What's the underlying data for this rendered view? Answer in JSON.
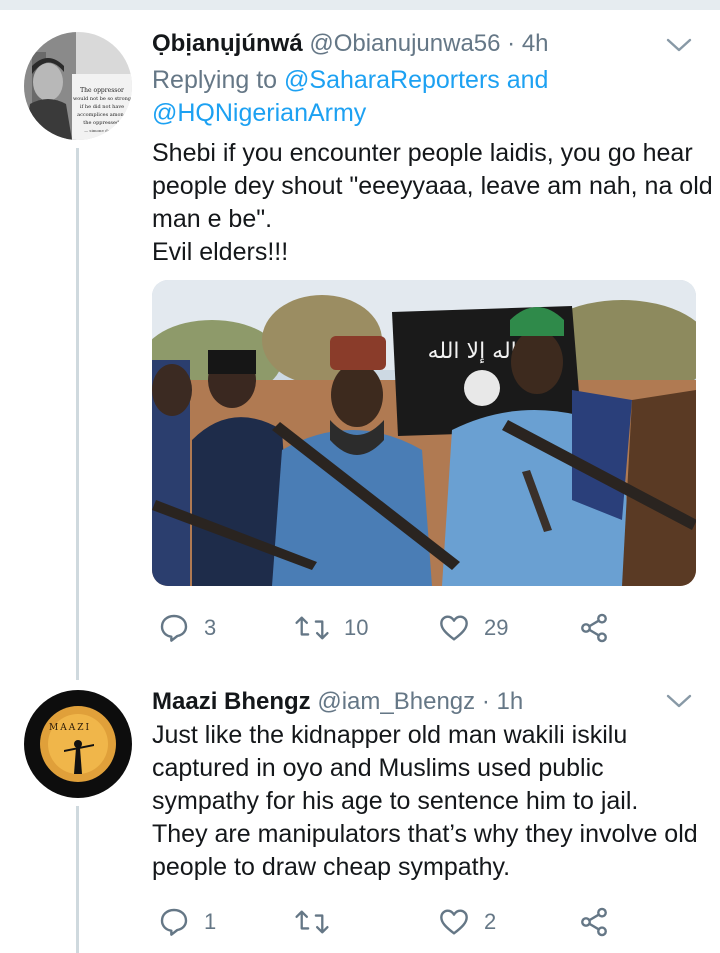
{
  "tweets": [
    {
      "name": "Ọbịanụjúnwá",
      "handle": "@Obianujunwa56",
      "time": "· 4h",
      "replying_prefix": "Replying to ",
      "replying_line1": "@SaharaReporters and",
      "replying_line2": "@HQNigerianArmy",
      "text_lines": [
        "Shebi if you encounter people laidis, you go hear",
        "people dey shout \"eeeyyaaa, leave am nah, na old",
        "man e be\".",
        "Evil elders!!!"
      ],
      "avatar_text": [
        "The oppressor",
        "would not be so strong",
        "if he did not have",
        "accomplices among",
        "the oppressed.",
        "— simone de Beauv"
      ],
      "media_banner_text": "لا إله إلا الله",
      "replies": "3",
      "retweets": "10",
      "likes": "29"
    },
    {
      "name": "Maazi Bhengz",
      "handle": "@iam_Bhengz",
      "time": "· 1h",
      "text_lines": [
        "Just like the kidnapper old man wakili iskilu",
        "captured in oyo and Muslims used public",
        "sympathy for his age to sentence him to jail.",
        "They are manipulators that’s why they involve old",
        "people to draw cheap sympathy."
      ],
      "avatar_text": "MAAZI",
      "replies": "1",
      "retweets": "",
      "likes": "2"
    }
  ],
  "colors": {
    "link": "#1da1f2",
    "secondary": "#657786",
    "thread_line": "#cfd9de"
  },
  "icons": [
    "reply-icon",
    "retweet-icon",
    "like-icon",
    "share-icon",
    "chevron-down-icon"
  ]
}
